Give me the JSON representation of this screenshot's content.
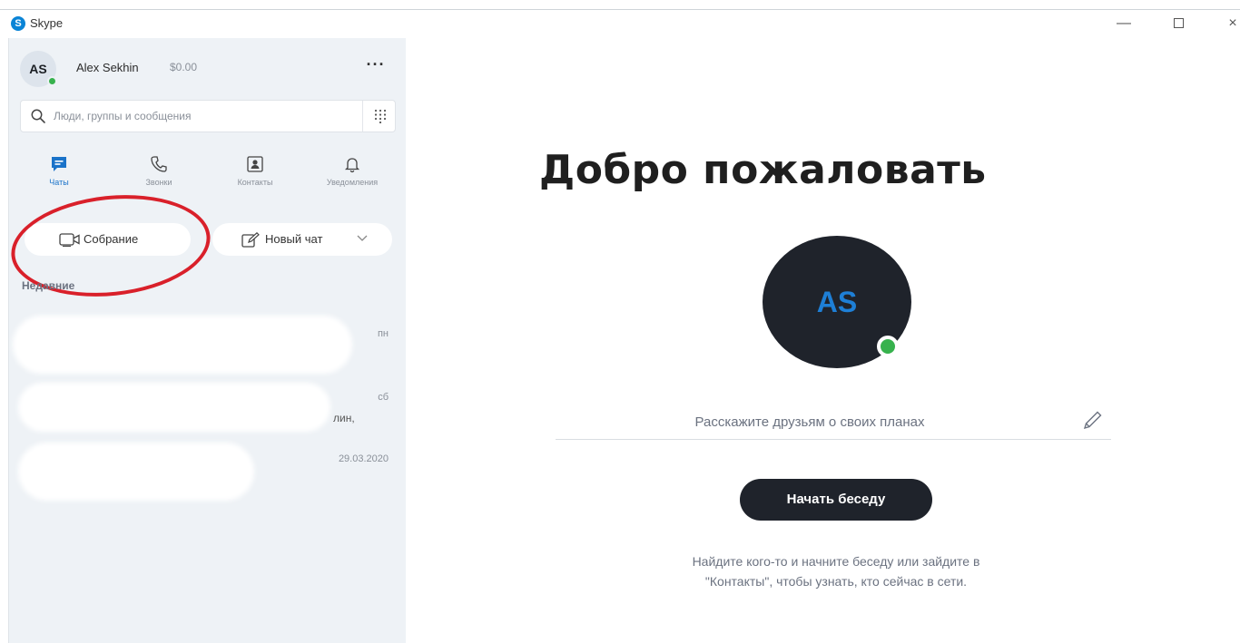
{
  "window": {
    "title": "Skype",
    "logo_letter": "S",
    "minimize": "—",
    "close": "×"
  },
  "profile": {
    "initials": "AS",
    "name": "Alex Sekhin",
    "balance": "$0.00",
    "more": "···"
  },
  "search": {
    "placeholder": "Люди, группы и сообщения"
  },
  "nav": {
    "tabs": [
      {
        "label": "Чаты",
        "icon": "chat-icon",
        "active": true
      },
      {
        "label": "Звонки",
        "icon": "phone-icon",
        "active": false
      },
      {
        "label": "Контакты",
        "icon": "contacts-icon",
        "active": false
      },
      {
        "label": "Уведомления",
        "icon": "bell-icon",
        "active": false
      }
    ]
  },
  "actions": {
    "meeting_label": "Собрание",
    "new_chat_label": "Новый чат"
  },
  "recent": {
    "label": "Недавние",
    "items": [
      {
        "time": "пн",
        "snippet": ""
      },
      {
        "time": "сб",
        "snippet": "лин,"
      },
      {
        "time": "29.03.2020",
        "snippet": ""
      }
    ]
  },
  "main": {
    "welcome": "Добро пожаловать",
    "avatar_initials": "AS",
    "status_placeholder": "Расскажите друзьям о своих планах",
    "start_button": "Начать беседу",
    "hint_line1": "Найдите кого-то и начните беседу или зайдите в",
    "hint_line2": "\"Контакты\", чтобы узнать, кто сейчас в сети."
  },
  "colors": {
    "accent": "#1a73c9",
    "sidebar_bg": "#eef2f6",
    "dark_button": "#1f232b",
    "presence": "#37b24d",
    "annotation_ring": "#d9202a"
  }
}
